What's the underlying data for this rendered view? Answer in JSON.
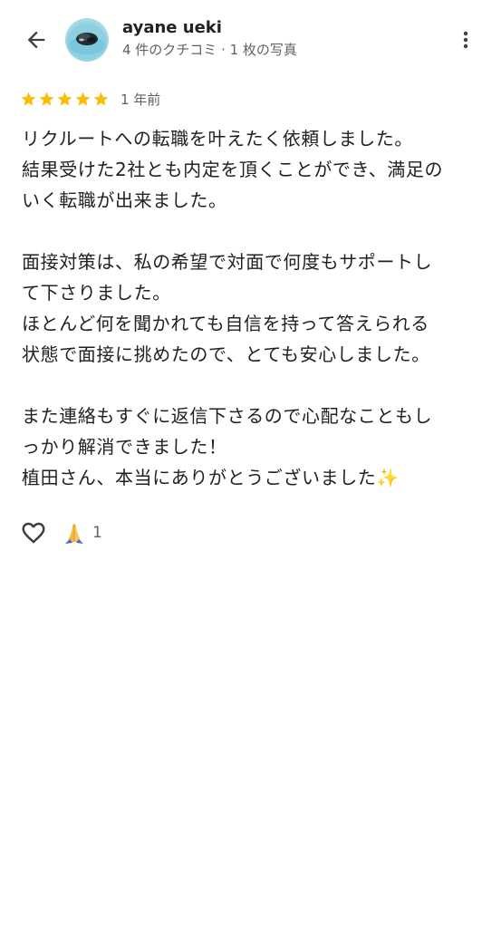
{
  "header": {
    "user_name": "ayane ueki",
    "user_meta": "4 件のクチコミ · 1 枚の写真",
    "back_icon": "arrow-back-icon",
    "more_icon": "more-vert-icon",
    "avatar_icon": "profile-photo"
  },
  "review": {
    "rating": 5,
    "max_rating": 5,
    "star_color": "#fbbc04",
    "date": "1 年前",
    "lines": [
      "リクルートへの転職を叶えたく依頼しました。",
      "結果受けた2社とも内定を頂くことができ、満足の",
      "いく転職が出来ました。",
      "",
      "面接対策は、私の希望で対面で何度もサポートし",
      "て下さりました。",
      "ほとんど何を聞かれても自信を持って答えられる",
      "状態で面接に挑めたので、とても安心しました。",
      "",
      "また連絡もすぐに返信下さるので心配なこともし",
      "っかり解消できました！",
      "植田さん、本当にありがとうございました✨"
    ]
  },
  "reactions": {
    "like_icon": "heart-outline-icon",
    "reaction_icon": "folded-hands-emoji",
    "reaction_count": "1"
  }
}
